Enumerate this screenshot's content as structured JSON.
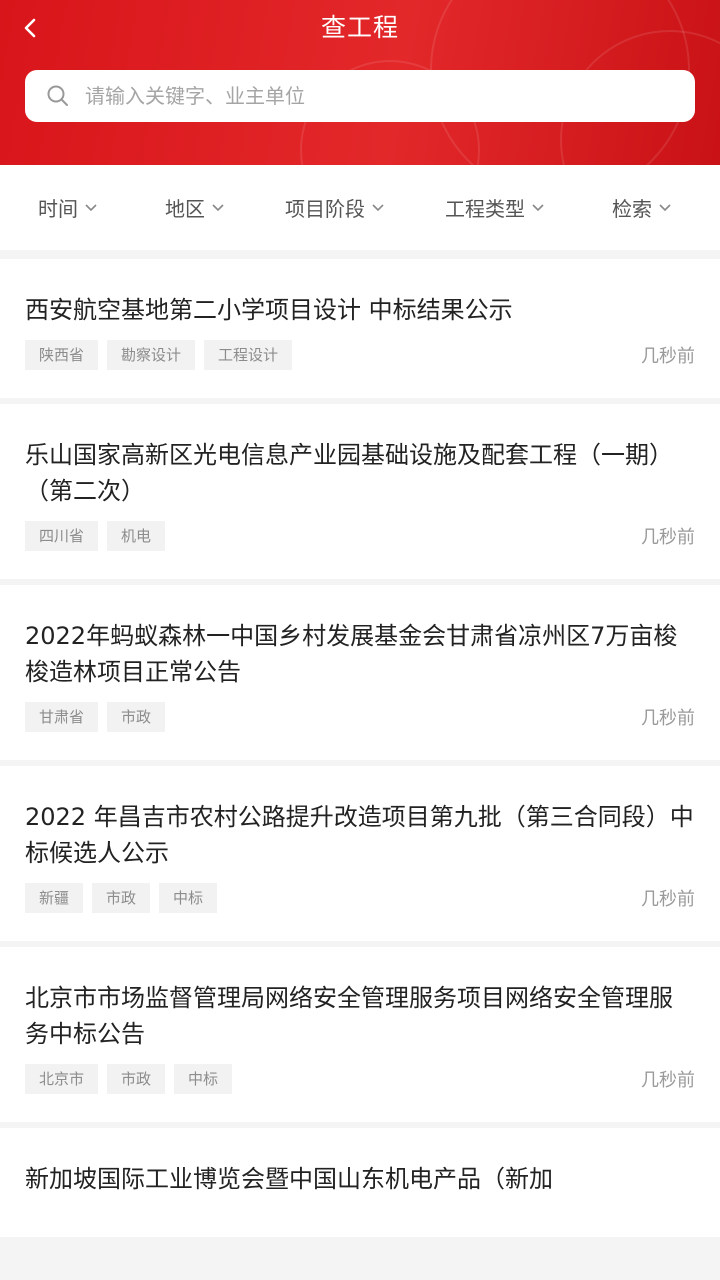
{
  "header": {
    "title": "查工程",
    "back_icon": "chevron-left-icon",
    "search": {
      "placeholder": "请输入关键字、业主单位",
      "value": ""
    }
  },
  "filters": [
    {
      "label": "时间"
    },
    {
      "label": "地区"
    },
    {
      "label": "项目阶段"
    },
    {
      "label": "工程类型"
    },
    {
      "label": "检索"
    }
  ],
  "items": [
    {
      "title": "西安航空基地第二小学项目设计 中标结果公示",
      "tags": [
        "陕西省",
        "勘察设计",
        "工程设计"
      ],
      "time": "几秒前"
    },
    {
      "title": "乐山国家高新区光电信息产业园基础设施及配套工程（一期）（第二次）",
      "tags": [
        "四川省",
        "机电"
      ],
      "time": "几秒前"
    },
    {
      "title": "2022年蚂蚁森林一中国乡村发展基金会甘肃省凉州区7万亩梭梭造林项目正常公告",
      "tags": [
        "甘肃省",
        "市政"
      ],
      "time": "几秒前"
    },
    {
      "title": "2022 年昌吉市农村公路提升改造项目第九批（第三合同段）中标候选人公示",
      "tags": [
        "新疆",
        "市政",
        "中标"
      ],
      "time": "几秒前"
    },
    {
      "title": "北京市市场监督管理局网络安全管理服务项目网络安全管理服务中标公告",
      "tags": [
        "北京市",
        "市政",
        "中标"
      ],
      "time": "几秒前"
    },
    {
      "title": "新加坡国际工业博览会暨中国山东机电产品（新加",
      "tags": [],
      "time": ""
    }
  ],
  "colors": {
    "brand_red": "#d8151a",
    "tag_bg": "#f2f2f2",
    "tag_text": "#8c8c8c"
  }
}
